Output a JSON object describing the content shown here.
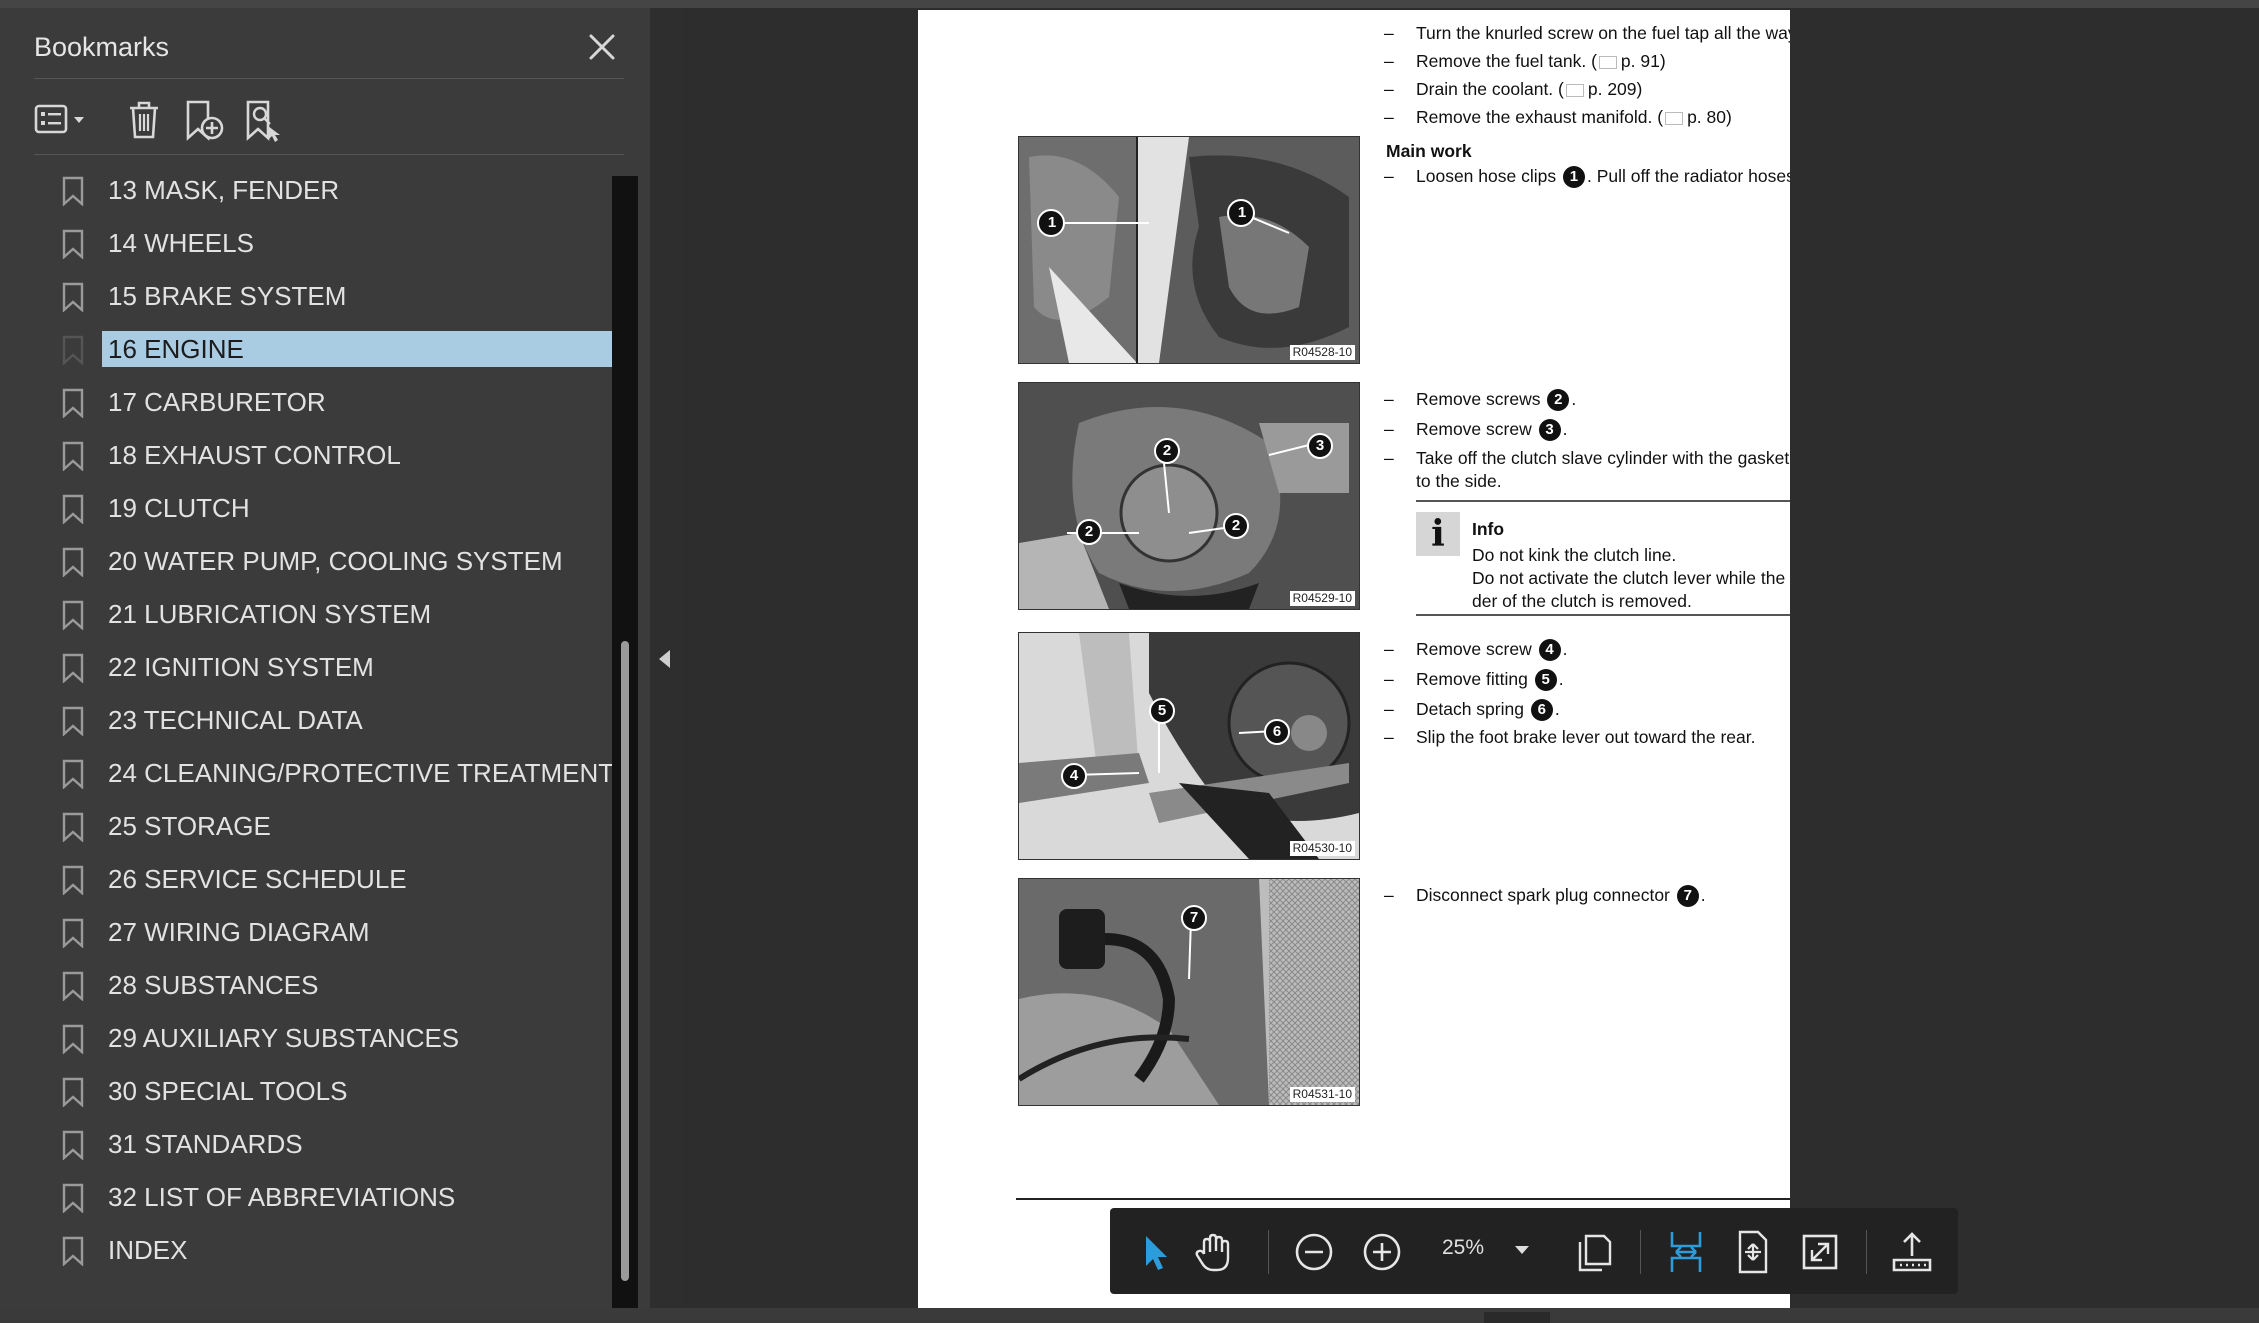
{
  "sidebar": {
    "title": "Bookmarks",
    "items": [
      {
        "label": "13 MASK, FENDER"
      },
      {
        "label": "14 WHEELS"
      },
      {
        "label": "15 BRAKE SYSTEM"
      },
      {
        "label": "16 ENGINE",
        "selected": true
      },
      {
        "label": "17 CARBURETOR"
      },
      {
        "label": "18 EXHAUST CONTROL"
      },
      {
        "label": "19 CLUTCH"
      },
      {
        "label": "20 WATER PUMP, COOLING SYSTEM"
      },
      {
        "label": "21 LUBRICATION SYSTEM"
      },
      {
        "label": "22 IGNITION SYSTEM"
      },
      {
        "label": "23 TECHNICAL DATA"
      },
      {
        "label": "24 CLEANING/PROTECTIVE TREATMENT"
      },
      {
        "label": "25 STORAGE"
      },
      {
        "label": "26 SERVICE SCHEDULE"
      },
      {
        "label": "27 WIRING DIAGRAM"
      },
      {
        "label": "28 SUBSTANCES"
      },
      {
        "label": "29 AUXILIARY SUBSTANCES"
      },
      {
        "label": "30 SPECIAL TOOLS"
      },
      {
        "label": "31 STANDARDS"
      },
      {
        "label": "32 LIST OF ABBREVIATIONS"
      },
      {
        "label": "INDEX"
      }
    ]
  },
  "page": {
    "prep": [
      {
        "text": "Turn the knurled screw on the fuel tap all the way clockwise."
      },
      {
        "text": "Remove the fuel tank. (",
        "ref": "p. 91)"
      },
      {
        "text": "Drain the coolant. (",
        "ref": "p. 209)"
      },
      {
        "text": "Remove the exhaust manifold. (",
        "ref": "p. 80)"
      }
    ],
    "main_heading": "Main work",
    "s1": {
      "pre": "Loosen hose clips ",
      "num": "1",
      "post": ". Pull off the radiator hoses."
    },
    "s2": [
      {
        "pre": "Remove screws ",
        "num": "2",
        "post": "."
      },
      {
        "pre": "Remove screw ",
        "num": "3",
        "post": "."
      },
      {
        "line1": "Take off the clutch slave cylinder with the gasket and hang it",
        "line2": "to the side."
      }
    ],
    "info": {
      "title": "Info",
      "icon": "i",
      "line1": "Do not kink the clutch line.",
      "line2": "Do not activate the clutch lever while the slave cylin-",
      "line3": "der of the clutch is removed."
    },
    "s3": [
      {
        "pre": "Remove screw ",
        "num": "4",
        "post": "."
      },
      {
        "pre": "Remove fitting ",
        "num": "5",
        "post": "."
      },
      {
        "pre": "Detach spring ",
        "num": "6",
        "post": "."
      },
      {
        "text": "Slip the foot brake lever out toward the rear."
      }
    ],
    "s4": {
      "pre": "Disconnect spark plug connector ",
      "num": "7",
      "post": "."
    },
    "dash": "–",
    "photos": [
      {
        "code": "R04528-10",
        "callouts": [
          "1",
          "1"
        ]
      },
      {
        "code": "R04529-10",
        "callouts": [
          "2",
          "3",
          "2",
          "2"
        ]
      },
      {
        "code": "R04530-10",
        "callouts": [
          "5",
          "6",
          "4"
        ]
      },
      {
        "code": "R04531-10",
        "callouts": [
          "7"
        ]
      }
    ]
  },
  "toolbar": {
    "zoom": "25%",
    "active_color": "#2d9cdb",
    "icons": [
      "select-arrow-icon",
      "hand-tool-icon",
      "zoom-out-icon",
      "zoom-in-icon",
      "page-display-icon",
      "fit-width-icon",
      "fit-page-icon",
      "full-screen-icon",
      "share-icon"
    ]
  }
}
